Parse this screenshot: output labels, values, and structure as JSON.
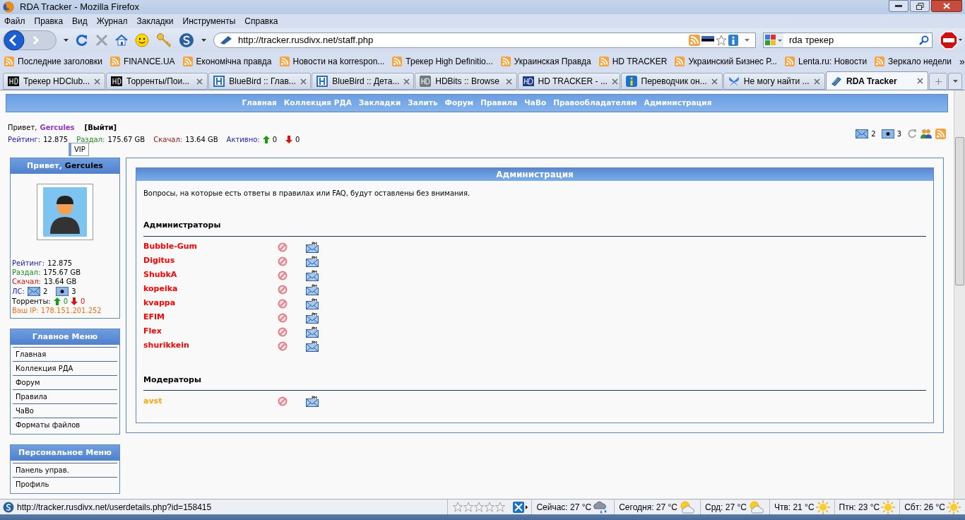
{
  "window": {
    "title": "RDA Tracker - Mozilla Firefox"
  },
  "menu": [
    "Файл",
    "Правка",
    "Вид",
    "Журнал",
    "Закладки",
    "Инструменты",
    "Справка"
  ],
  "address": {
    "value": "http://tracker.rusdivx.net/staff.php"
  },
  "search": {
    "value": "rda трекер"
  },
  "bookmarks": [
    "Последние заголовки",
    "FINANCE.UA",
    "Економічна правда",
    "Новости на korrespon...",
    "Трекер High Definitio...",
    "Украинская Правда",
    "HD TRACKER",
    "Украинский Бизнес Р...",
    "Lenta.ru: Новости",
    "Зеркало недели"
  ],
  "bookmarks_more": "»",
  "tabs": [
    {
      "label": "Трекер HDClub...",
      "selected": false,
      "kind": "hd"
    },
    {
      "label": "Торренты/Пои...",
      "selected": false,
      "kind": "hd"
    },
    {
      "label": "BlueBird :: Глав...",
      "selected": false,
      "kind": "bb"
    },
    {
      "label": "BlueBird :: Дета...",
      "selected": false,
      "kind": "bb"
    },
    {
      "label": "HDBits :: Browse",
      "selected": false,
      "kind": "hdbits"
    },
    {
      "label": "HD TRACKER - ...",
      "selected": false,
      "kind": "hdt"
    },
    {
      "label": "Переводчик он...",
      "selected": false,
      "kind": "info"
    },
    {
      "label": "Не могу найти ...",
      "selected": false,
      "kind": "fly"
    },
    {
      "label": "RDA Tracker",
      "selected": true,
      "kind": "rda"
    }
  ],
  "site_nav": [
    "Главная",
    "Коллекция РДА",
    "Закладки",
    "Залить",
    "Форум",
    "Правила",
    "ЧаВо",
    "Правообладателям",
    "Администрация"
  ],
  "user_bar": {
    "greeting": "Привет,",
    "username": "Gercules",
    "logout": "[Выйти]",
    "rating_label": "Рейтинг:",
    "rating": "12.875",
    "upload_label": "Раздал:",
    "upload": "175.67 GB",
    "download_label": "Скачал:",
    "download": "13.64 GB",
    "active_label": "Активно:",
    "seeding": "0",
    "leeching": "0",
    "tooltip": "VIP",
    "messages": "2",
    "pm": "3"
  },
  "user_box": {
    "greeting": "Привет,",
    "username": "Gercules",
    "rating_label": "Рейтинг:",
    "rating": "12.875",
    "upload_label": "Раздал:",
    "upload": "175.67 GB",
    "download_label": "Скачал:",
    "download": "13.64 GB",
    "pm_label": "ЛС:",
    "inbox": "2",
    "outbox": "3",
    "torrents_label": "Торренты:",
    "seeding": "0",
    "leeching": "0",
    "ip": "Ваш IP: 178.151.201.252"
  },
  "main_menu": {
    "title": "Главное Меню",
    "items": [
      "Главная",
      "Коллекция РДА",
      "Форум",
      "Правила",
      "ЧаВо",
      "Форматы файлов"
    ]
  },
  "personal_menu": {
    "title": "Персональное Меню",
    "items": [
      "Панель управ.",
      "Профиль"
    ]
  },
  "panel": {
    "title": "Администрация",
    "notice": "Вопросы, на которые есть ответы в правилах или FAQ, будут оставлены без внимания.",
    "sections": [
      {
        "title": "Администраторы",
        "members": [
          {
            "name": "Bubble-Gum",
            "color": "#ff0000"
          },
          {
            "name": "Digitus",
            "color": "#ff0000"
          },
          {
            "name": "ShubkA",
            "color": "#ff0000"
          },
          {
            "name": "kopeika",
            "color": "#ff0000"
          },
          {
            "name": "kvappa",
            "color": "#ff0000"
          },
          {
            "name": "EFIM",
            "color": "#ff0000"
          },
          {
            "name": "Flex",
            "color": "#ff0000"
          },
          {
            "name": "shurikkein",
            "color": "#ff0000"
          }
        ]
      },
      {
        "title": "Модераторы",
        "members": [
          {
            "name": "avst",
            "color": "#ffa500"
          }
        ]
      }
    ]
  },
  "status_bar": {
    "url": "http://tracker.rusdivx.net/userdetails.php?id=158415",
    "weather": [
      {
        "label": "Сейчас: 27 °C",
        "kind": "rain"
      },
      {
        "label": "Сегодня: 27 °C",
        "kind": "cloud-sun"
      },
      {
        "label": "Срд: 27 °C",
        "kind": "cloud-sun"
      },
      {
        "label": "Чтв: 21 °C",
        "kind": "sun"
      },
      {
        "label": "Птн: 23 °C",
        "kind": "sun"
      },
      {
        "label": "Сбт: 26 °C",
        "kind": "sun"
      }
    ]
  }
}
